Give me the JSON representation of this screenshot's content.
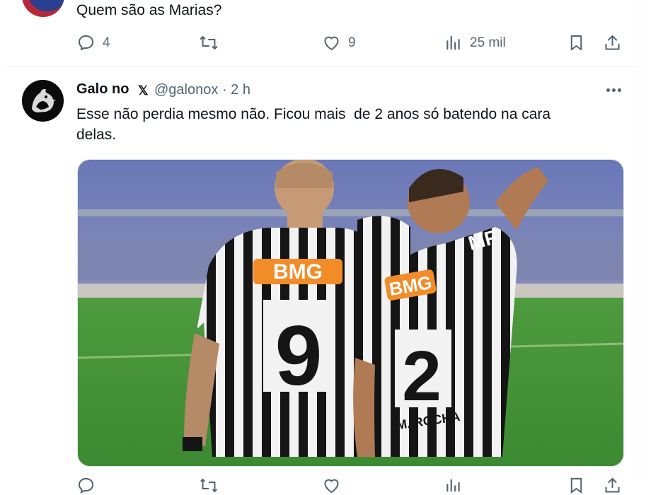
{
  "prev_tweet": {
    "text": "Quem são as Marias?",
    "actions": {
      "replies": "4",
      "retweets": "",
      "likes": "9",
      "views": "25 mil"
    }
  },
  "tweet": {
    "author_name": "Galo no",
    "x_logo": "𝕏",
    "handle": "@galonox",
    "time": "· 2 h",
    "text_line1": "Esse não perdia mesmo não. Ficou mais  de 2 anos só batendo na cara",
    "text_line2": "delas.",
    "image": {
      "jersey_sponsor_left": "BMG",
      "jersey_sponsor_right": "BMG",
      "number_left": "9",
      "number_right": "2",
      "name_right": "M. ROCHA",
      "brand_right": "MF"
    }
  },
  "colors": {
    "text": "#0f1419",
    "secondary": "#536471",
    "divider": "#eff3f4",
    "sponsor": "#f28c28"
  }
}
